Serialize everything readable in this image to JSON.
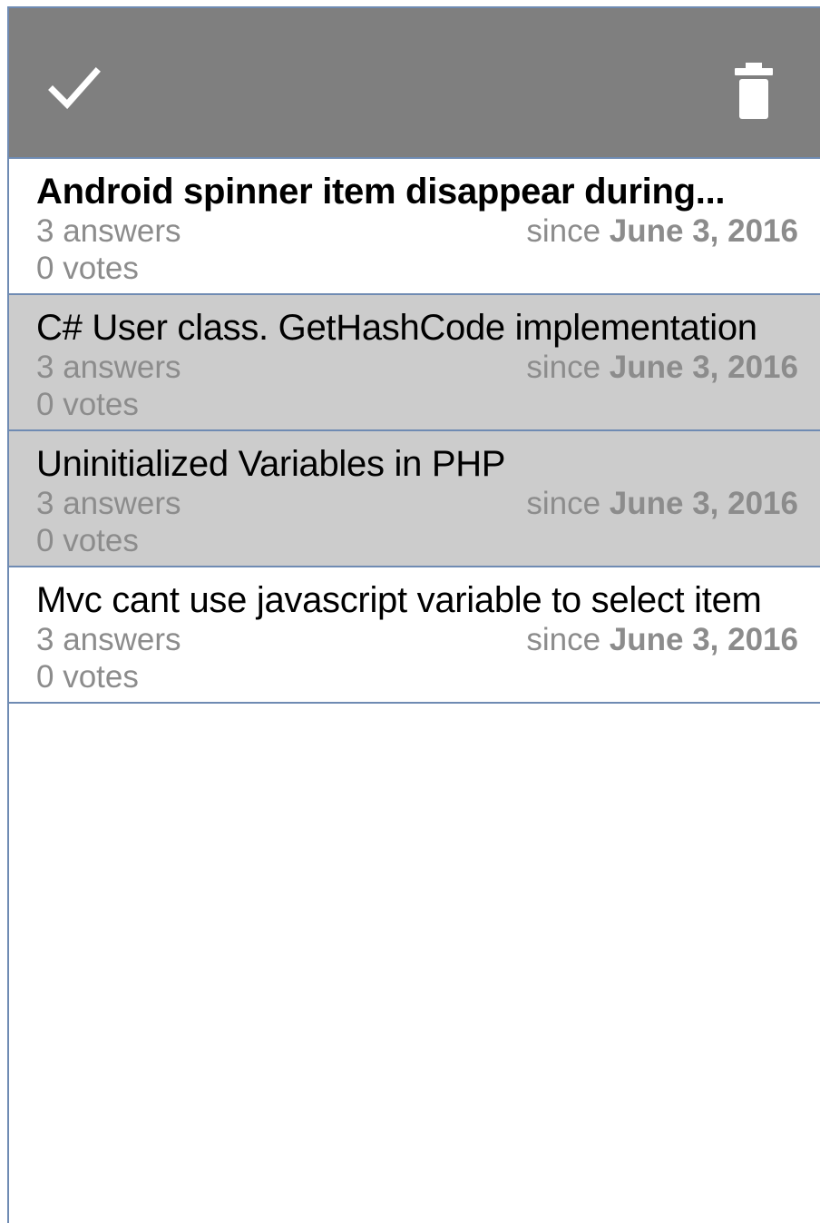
{
  "toolbar": {
    "check_icon": "checkmark-icon",
    "trash_icon": "trash-icon",
    "background": "#7f7f7f"
  },
  "questions": [
    {
      "title": "Android spinner item disappear during...",
      "answers": "3 answers",
      "votes": "0 votes",
      "since_prefix": "since",
      "date": "June 3, 2016",
      "selected": false,
      "bold": true
    },
    {
      "title": "C# User class. GetHashCode implementation",
      "answers": "3 answers",
      "votes": "0 votes",
      "since_prefix": "since",
      "date": "June 3, 2016",
      "selected": true,
      "bold": false
    },
    {
      "title": "Uninitialized Variables in PHP",
      "answers": "3 answers",
      "votes": "0 votes",
      "since_prefix": "since",
      "date": "June 3, 2016",
      "selected": true,
      "bold": false
    },
    {
      "title": "Mvc cant use javascript variable to select item",
      "answers": "3 answers",
      "votes": "0 votes",
      "since_prefix": "since",
      "date": "June 3, 2016",
      "selected": false,
      "bold": false
    }
  ],
  "colors": {
    "selected_row": "#cccccc",
    "divider": "#6f8bb3",
    "meta_text": "#8c8c8c"
  }
}
